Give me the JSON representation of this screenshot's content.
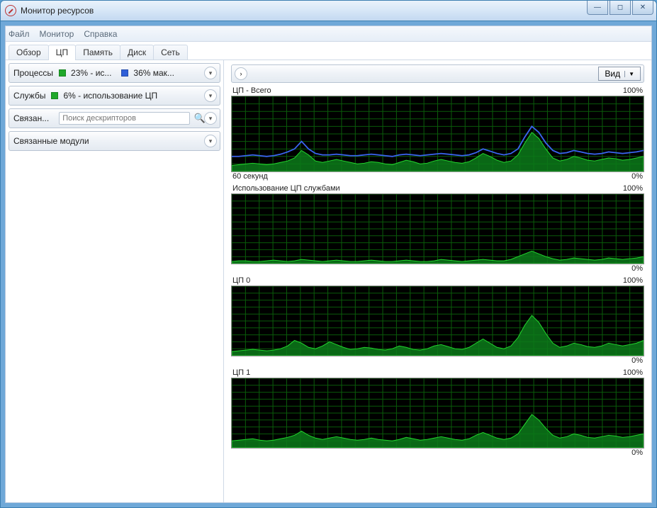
{
  "window": {
    "title": "Монитор ресурсов"
  },
  "menu": {
    "file": "Файл",
    "monitor": "Монитор",
    "help": "Справка"
  },
  "tabs": {
    "overview": "Обзор",
    "cpu": "ЦП",
    "memory": "Память",
    "disk": "Диск",
    "network": "Сеть",
    "active": "cpu"
  },
  "left": {
    "processes": {
      "label": "Процессы",
      "usage": "23% - ис...",
      "max": "36% мак..."
    },
    "services": {
      "label": "Службы",
      "usage": "6% - использование ЦП"
    },
    "handles": {
      "label": "Связан...",
      "search_placeholder": "Поиск дескрипторов"
    },
    "modules": {
      "label": "Связанные модули"
    }
  },
  "right": {
    "view_label": "Вид",
    "axis_max": "100%",
    "axis_min": "0%",
    "time_label": "60 секунд",
    "charts": [
      {
        "title": "ЦП - Всего"
      },
      {
        "title": "Использование ЦП службами"
      },
      {
        "title": "ЦП 0"
      },
      {
        "title": "ЦП 1"
      }
    ]
  },
  "colors": {
    "green_swatch": "#1fa82a",
    "blue_swatch": "#2f5fd8"
  },
  "chart_data": [
    {
      "type": "area",
      "title": "ЦП - Всего",
      "ylabel": "%",
      "ylim": [
        0,
        100
      ],
      "xlabel": "",
      "xrange_seconds": 60,
      "series": [
        {
          "name": "Использование ЦП",
          "color": "#1fa82a",
          "values": [
            8,
            9,
            10,
            11,
            10,
            9,
            10,
            12,
            14,
            18,
            28,
            22,
            14,
            12,
            14,
            16,
            14,
            12,
            10,
            11,
            13,
            12,
            10,
            9,
            12,
            15,
            13,
            10,
            11,
            14,
            16,
            14,
            12,
            11,
            13,
            18,
            24,
            20,
            15,
            12,
            14,
            22,
            38,
            52,
            44,
            30,
            18,
            14,
            16,
            20,
            18,
            15,
            14,
            16,
            18,
            17,
            15,
            16,
            18,
            20
          ]
        },
        {
          "name": "Максимальная частота",
          "color": "#2f5fd8",
          "values": [
            20,
            20,
            21,
            22,
            21,
            20,
            21,
            23,
            26,
            30,
            40,
            30,
            24,
            22,
            22,
            23,
            22,
            21,
            21,
            22,
            23,
            22,
            21,
            20,
            22,
            23,
            22,
            21,
            22,
            23,
            24,
            23,
            22,
            21,
            22,
            25,
            30,
            27,
            24,
            22,
            24,
            30,
            46,
            60,
            52,
            38,
            28,
            24,
            25,
            28,
            26,
            24,
            23,
            24,
            26,
            25,
            24,
            25,
            26,
            28
          ]
        }
      ]
    },
    {
      "type": "area",
      "title": "Использование ЦП службами",
      "ylabel": "%",
      "ylim": [
        0,
        100
      ],
      "series": [
        {
          "name": "Службы",
          "color": "#1fa82a",
          "values": [
            3,
            4,
            4,
            3,
            3,
            4,
            5,
            4,
            3,
            4,
            6,
            5,
            4,
            3,
            4,
            5,
            4,
            3,
            3,
            4,
            5,
            4,
            3,
            3,
            4,
            5,
            4,
            3,
            3,
            4,
            6,
            5,
            4,
            3,
            4,
            5,
            6,
            5,
            4,
            4,
            6,
            10,
            14,
            18,
            14,
            10,
            7,
            5,
            6,
            8,
            7,
            6,
            5,
            6,
            8,
            7,
            6,
            7,
            8,
            10
          ]
        }
      ]
    },
    {
      "type": "area",
      "title": "ЦП 0",
      "ylabel": "%",
      "ylim": [
        0,
        100
      ],
      "series": [
        {
          "name": "ЦП 0",
          "color": "#1fa82a",
          "values": [
            6,
            7,
            8,
            9,
            8,
            7,
            8,
            10,
            14,
            22,
            18,
            12,
            10,
            14,
            20,
            16,
            12,
            9,
            10,
            12,
            11,
            9,
            8,
            10,
            14,
            12,
            9,
            8,
            10,
            14,
            16,
            13,
            10,
            9,
            12,
            18,
            24,
            18,
            12,
            10,
            14,
            26,
            44,
            58,
            48,
            32,
            18,
            12,
            14,
            18,
            16,
            13,
            12,
            14,
            18,
            16,
            14,
            16,
            18,
            22
          ]
        }
      ]
    },
    {
      "type": "area",
      "title": "ЦП 1",
      "ylabel": "%",
      "ylim": [
        0,
        100
      ],
      "series": [
        {
          "name": "ЦП 1",
          "color": "#1fa82a",
          "values": [
            10,
            11,
            12,
            13,
            11,
            10,
            11,
            13,
            15,
            18,
            24,
            18,
            14,
            12,
            14,
            16,
            14,
            12,
            11,
            12,
            14,
            12,
            11,
            10,
            12,
            15,
            13,
            11,
            12,
            14,
            16,
            14,
            12,
            11,
            13,
            18,
            22,
            18,
            14,
            12,
            14,
            20,
            34,
            48,
            40,
            28,
            18,
            14,
            16,
            20,
            18,
            15,
            14,
            16,
            18,
            17,
            15,
            16,
            18,
            20
          ]
        }
      ]
    }
  ]
}
